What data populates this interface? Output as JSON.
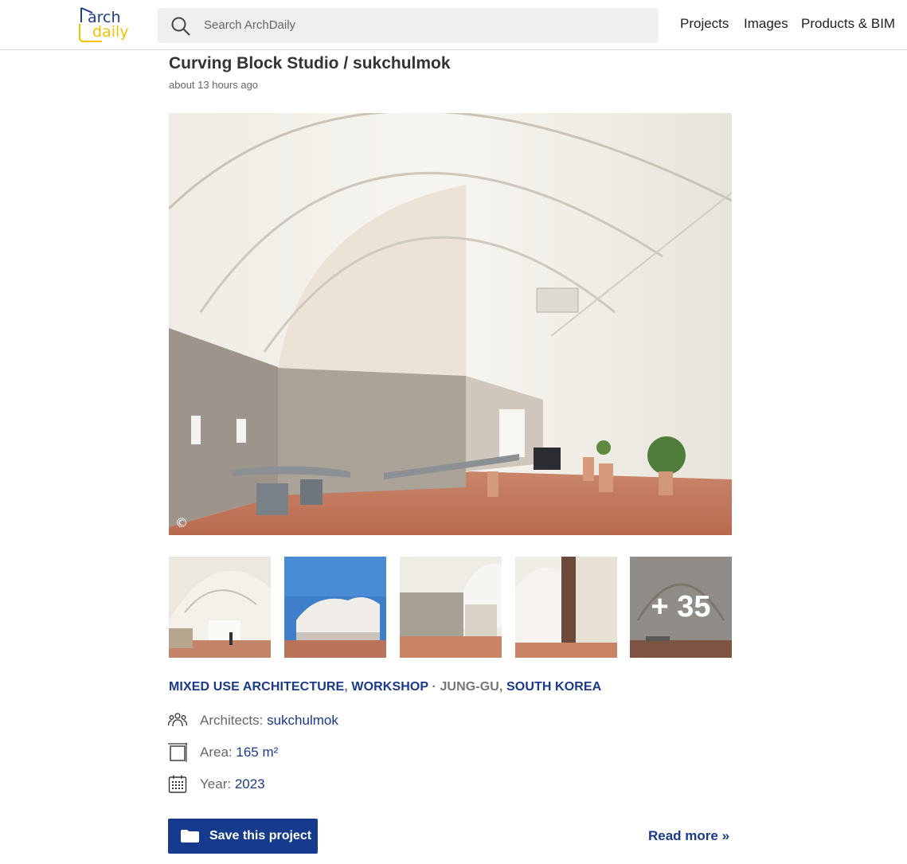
{
  "header": {
    "logo_line1": "arch",
    "logo_line2": "daily",
    "search_placeholder": "Search ArchDaily",
    "nav": [
      "Projects",
      "Images",
      "Products & BIM"
    ]
  },
  "article": {
    "title": "Curving Block Studio / sukchulmok",
    "time": "about 13 hours ago",
    "copyright_symbol": "©"
  },
  "gallery": {
    "more_count": "+ 35"
  },
  "tags": {
    "cat1": "MIXED USE ARCHITECTURE",
    "comma1": ",",
    "cat2": "WORKSHOP",
    "dot": "·",
    "loc1": "JUNG-GU",
    "comma2": ",",
    "loc2": "SOUTH KOREA"
  },
  "specs": {
    "architects_label": "Architects:",
    "architects_value": "sukchulmok",
    "area_label": "Area:",
    "area_value": "165 m²",
    "year_label": "Year:",
    "year_value": "2023"
  },
  "actions": {
    "save_label": "Save this project",
    "read_more": "Read more »"
  },
  "colors": {
    "brand_blue": "#153a8e",
    "link_blue": "#1a3a8a",
    "logo_yellow": "#f2c200"
  }
}
